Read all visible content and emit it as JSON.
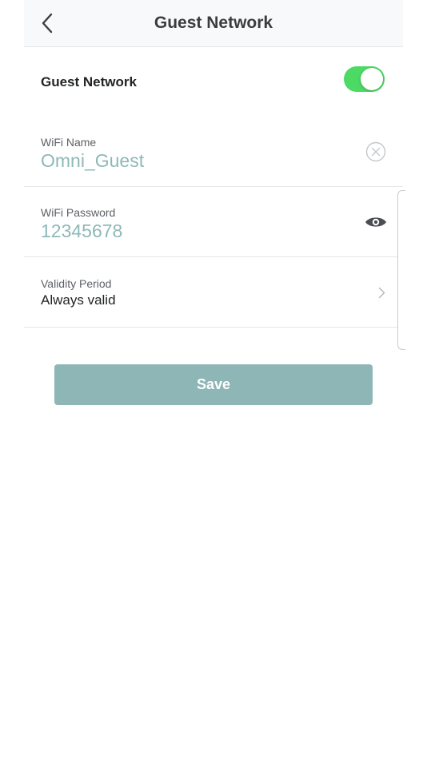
{
  "header": {
    "title": "Guest Network",
    "back_icon": "chevron-left-icon"
  },
  "guest_network": {
    "label": "Guest Network",
    "enabled": true,
    "toggle_color": "#4cd964"
  },
  "wifi_name": {
    "label": "WiFi Name",
    "value": "Omni_Guest",
    "clear_icon": "clear-circle-icon"
  },
  "wifi_password": {
    "label": "WiFi Password",
    "value": "12345678",
    "visibility_icon": "eye-icon"
  },
  "validity": {
    "label": "Validity Period",
    "value": "Always valid",
    "chevron_icon": "chevron-right-icon"
  },
  "save": {
    "label": "Save",
    "color": "#8fb6b6"
  },
  "colors": {
    "value_accent": "#8fb8b8",
    "divider": "#e4e6ea"
  }
}
